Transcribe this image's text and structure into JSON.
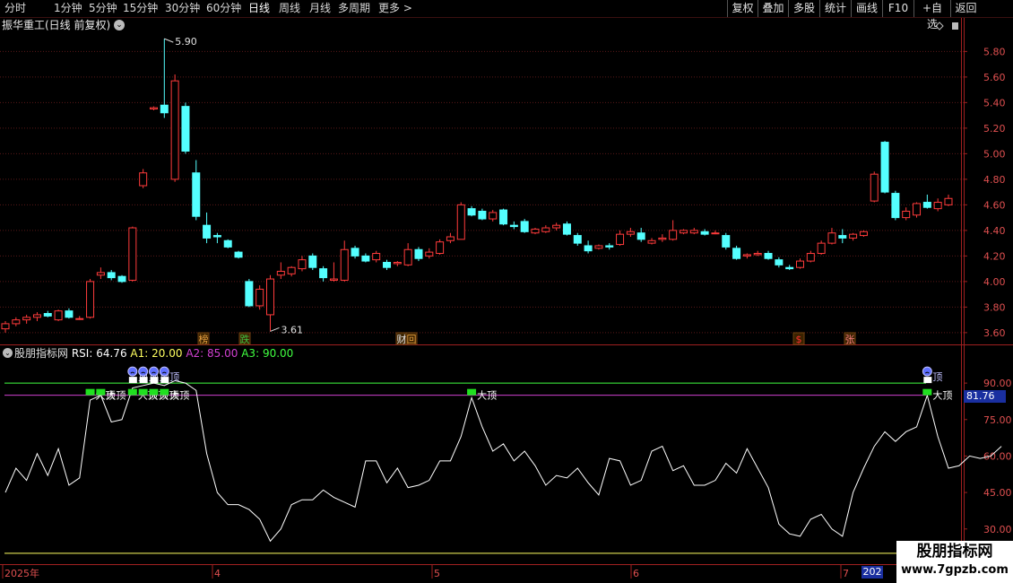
{
  "toolbar": {
    "periods": [
      "分时",
      "1分钟",
      "5分钟",
      "15分钟",
      "30分钟",
      "60分钟",
      "日线",
      "周线",
      "月线",
      "多周期",
      "更多"
    ],
    "more_arrow": ">",
    "active_period": "日线",
    "right_buttons": [
      "复权",
      "叠加",
      "多股",
      "统计",
      "画线",
      "F10",
      "+自选",
      "返回"
    ]
  },
  "main_panel": {
    "title": "振华重工(日线 前复权)",
    "price_axis": [
      "5.80",
      "5.60",
      "5.40",
      "5.20",
      "5.00",
      "4.80",
      "4.60",
      "4.40",
      "4.20",
      "4.00",
      "3.80",
      "3.60"
    ],
    "high_label": "5.90",
    "low_label": "3.61",
    "event_tags": [
      {
        "text": "榜",
        "color": "#e8a040"
      },
      {
        "text": "跌",
        "color": "#40c040"
      },
      {
        "text": "财",
        "color": "#e8e8e8"
      },
      {
        "text": "回",
        "color": "#e8a040"
      },
      {
        "text": "$",
        "color": "#ff3030"
      },
      {
        "text": "张",
        "color": "#ff8080"
      }
    ],
    "colors": {
      "up": "#ff3b3b",
      "down": "#54ffff",
      "grid": "#5a1818"
    }
  },
  "indicator_panel": {
    "name": "股朋指标网",
    "rsi_label": "RSI:",
    "rsi_value": "64.76",
    "a1_label": "A1:",
    "a1_value": "20.00",
    "a2_label": "A2:",
    "a2_value": "85.00",
    "a3_label": "A3:",
    "a3_value": "90.00",
    "axis_labels": [
      "90.00",
      "75.00",
      "60.00",
      "45.00",
      "30.00"
    ],
    "current_value_box": "81.76",
    "signal_big_top": "大顶",
    "signal_top": "顶",
    "colors": {
      "rsi": "#ffffff",
      "a1": "#ffff60",
      "a2": "#d040d0",
      "a3": "#40ff40"
    }
  },
  "time_axis": {
    "labels": [
      "2025年",
      "4",
      "5",
      "6",
      "7"
    ],
    "current_date_box": "202"
  },
  "watermark": {
    "line1": "股朋指标网",
    "line2": "www.7gpzb.com"
  },
  "chart_data": {
    "type": "candlestick",
    "price_ylim": [
      3.55,
      5.95
    ],
    "candles": [
      [
        3.63,
        3.69,
        3.6,
        3.67
      ],
      [
        3.67,
        3.72,
        3.65,
        3.7
      ],
      [
        3.7,
        3.74,
        3.67,
        3.72
      ],
      [
        3.72,
        3.76,
        3.69,
        3.74
      ],
      [
        3.75,
        3.77,
        3.72,
        3.73
      ],
      [
        3.7,
        3.78,
        3.69,
        3.77
      ],
      [
        3.77,
        3.79,
        3.71,
        3.72
      ],
      [
        3.71,
        3.73,
        3.7,
        3.71
      ],
      [
        3.72,
        4.02,
        3.71,
        4.0
      ],
      [
        4.05,
        4.11,
        4.02,
        4.07
      ],
      [
        4.07,
        4.09,
        4.01,
        4.03
      ],
      [
        4.04,
        4.05,
        3.99,
        4.0
      ],
      [
        4.01,
        4.43,
        4.0,
        4.42
      ],
      [
        4.75,
        4.88,
        4.73,
        4.85
      ],
      [
        5.35,
        5.37,
        5.34,
        5.36
      ],
      [
        5.38,
        5.9,
        5.28,
        5.32
      ],
      [
        4.8,
        5.62,
        4.78,
        5.57
      ],
      [
        5.37,
        5.4,
        5.0,
        5.02
      ],
      [
        4.85,
        4.95,
        4.48,
        4.51
      ],
      [
        4.44,
        4.54,
        4.3,
        4.34
      ],
      [
        4.36,
        4.38,
        4.3,
        4.35
      ],
      [
        4.32,
        4.33,
        4.26,
        4.27
      ],
      [
        4.23,
        4.24,
        4.18,
        4.19
      ],
      [
        4.0,
        4.02,
        3.8,
        3.81
      ],
      [
        3.81,
        3.97,
        3.78,
        3.94
      ],
      [
        3.74,
        4.05,
        3.61,
        4.02
      ],
      [
        4.05,
        4.15,
        4.02,
        4.08
      ],
      [
        4.06,
        4.12,
        4.04,
        4.11
      ],
      [
        4.1,
        4.2,
        4.08,
        4.17
      ],
      [
        4.2,
        4.22,
        4.09,
        4.11
      ],
      [
        4.1,
        4.12,
        4.0,
        4.03
      ],
      [
        4.01,
        4.15,
        4.0,
        4.02
      ],
      [
        4.01,
        4.32,
        4.0,
        4.25
      ],
      [
        4.26,
        4.28,
        4.18,
        4.2
      ],
      [
        4.2,
        4.22,
        4.15,
        4.16
      ],
      [
        4.17,
        4.24,
        4.15,
        4.22
      ],
      [
        4.15,
        4.17,
        4.09,
        4.11
      ],
      [
        4.14,
        4.16,
        4.12,
        4.15
      ],
      [
        4.13,
        4.3,
        4.12,
        4.25
      ],
      [
        4.25,
        4.27,
        4.16,
        4.18
      ],
      [
        4.2,
        4.26,
        4.18,
        4.23
      ],
      [
        4.22,
        4.33,
        4.21,
        4.31
      ],
      [
        4.32,
        4.38,
        4.3,
        4.35
      ],
      [
        4.33,
        4.62,
        4.33,
        4.6
      ],
      [
        4.57,
        4.59,
        4.51,
        4.52
      ],
      [
        4.55,
        4.57,
        4.48,
        4.49
      ],
      [
        4.49,
        4.56,
        4.47,
        4.54
      ],
      [
        4.56,
        4.57,
        4.44,
        4.45
      ],
      [
        4.44,
        4.47,
        4.41,
        4.43
      ],
      [
        4.47,
        4.49,
        4.38,
        4.39
      ],
      [
        4.38,
        4.42,
        4.37,
        4.41
      ],
      [
        4.39,
        4.44,
        4.38,
        4.42
      ],
      [
        4.42,
        4.46,
        4.4,
        4.44
      ],
      [
        4.45,
        4.47,
        4.36,
        4.37
      ],
      [
        4.36,
        4.38,
        4.28,
        4.3
      ],
      [
        4.28,
        4.32,
        4.22,
        4.24
      ],
      [
        4.26,
        4.29,
        4.25,
        4.28
      ],
      [
        4.28,
        4.3,
        4.25,
        4.27
      ],
      [
        4.29,
        4.4,
        4.28,
        4.37
      ],
      [
        4.37,
        4.42,
        4.35,
        4.39
      ],
      [
        4.38,
        4.42,
        4.31,
        4.33
      ],
      [
        4.3,
        4.34,
        4.29,
        4.32
      ],
      [
        4.33,
        4.37,
        4.31,
        4.34
      ],
      [
        4.33,
        4.48,
        4.32,
        4.4
      ],
      [
        4.38,
        4.41,
        4.37,
        4.4
      ],
      [
        4.38,
        4.42,
        4.37,
        4.4
      ],
      [
        4.39,
        4.41,
        4.36,
        4.37
      ],
      [
        4.38,
        4.4,
        4.37,
        4.38
      ],
      [
        4.36,
        4.38,
        4.25,
        4.27
      ],
      [
        4.26,
        4.28,
        4.17,
        4.18
      ],
      [
        4.2,
        4.22,
        4.18,
        4.21
      ],
      [
        4.21,
        4.24,
        4.2,
        4.22
      ],
      [
        4.22,
        4.24,
        4.17,
        4.18
      ],
      [
        4.17,
        4.19,
        4.11,
        4.13
      ],
      [
        4.11,
        4.13,
        4.09,
        4.1
      ],
      [
        4.11,
        4.18,
        4.1,
        4.16
      ],
      [
        4.16,
        4.24,
        4.15,
        4.22
      ],
      [
        4.22,
        4.32,
        4.21,
        4.3
      ],
      [
        4.3,
        4.42,
        4.29,
        4.38
      ],
      [
        4.36,
        4.41,
        4.3,
        4.34
      ],
      [
        4.34,
        4.38,
        4.32,
        4.37
      ],
      [
        4.36,
        4.4,
        4.35,
        4.39
      ],
      [
        4.63,
        4.86,
        4.62,
        4.84
      ],
      [
        5.09,
        5.1,
        4.69,
        4.7
      ],
      [
        4.69,
        4.71,
        4.48,
        4.5
      ],
      [
        4.5,
        4.58,
        4.48,
        4.55
      ],
      [
        4.52,
        4.62,
        4.5,
        4.61
      ],
      [
        4.62,
        4.68,
        4.57,
        4.58
      ],
      [
        4.57,
        4.65,
        4.55,
        4.62
      ],
      [
        4.6,
        4.68,
        4.59,
        4.65
      ]
    ],
    "rsi": [
      45,
      55,
      50,
      61,
      52,
      63,
      48,
      51,
      83,
      85,
      74,
      75,
      88,
      89,
      90,
      89,
      91,
      90,
      87,
      61,
      45,
      40,
      40,
      38,
      34,
      25,
      30,
      40,
      42,
      42,
      46,
      43,
      41,
      39,
      58,
      58,
      49,
      55,
      47,
      48,
      50,
      58,
      58,
      68,
      84,
      72,
      62,
      65,
      58,
      62,
      56,
      48,
      52,
      51,
      55,
      49,
      44,
      59,
      58,
      48,
      50,
      62,
      64,
      54,
      56,
      48,
      48,
      50,
      57,
      53,
      63,
      55,
      47,
      32,
      28,
      27,
      34,
      36,
      30,
      27,
      45,
      55,
      64,
      70,
      66,
      70,
      72,
      85,
      68,
      55,
      56,
      60,
      59,
      60,
      64
    ],
    "reference_lines": {
      "A1": 20,
      "A2": 85,
      "A3": 90
    },
    "rsi_ylim": [
      17,
      100
    ],
    "big_top_signal_index": [
      8,
      9,
      12,
      13,
      14,
      15,
      44,
      87
    ],
    "top_signal_index": [
      12,
      13,
      14,
      15,
      87
    ]
  }
}
